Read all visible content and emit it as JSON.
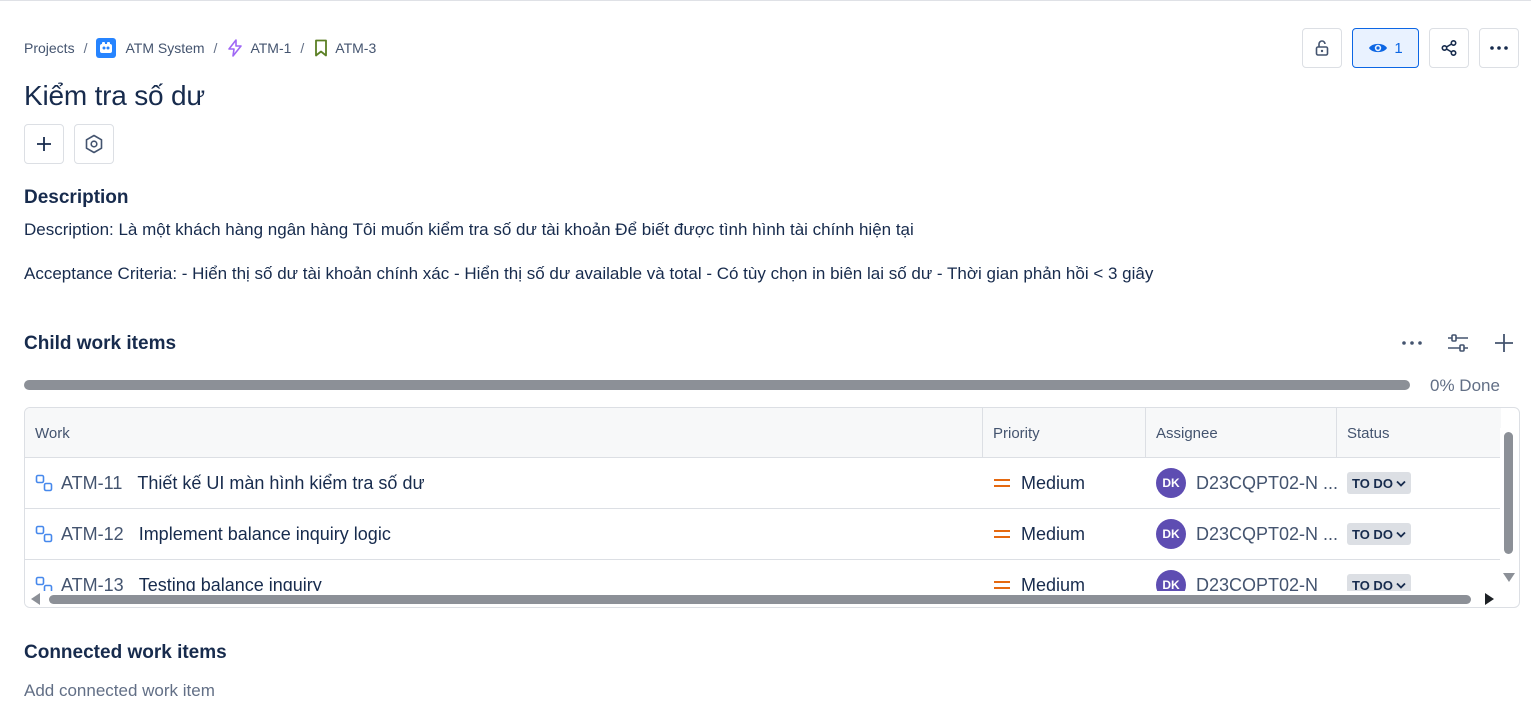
{
  "breadcrumb": {
    "projects": "Projects",
    "project": "ATM System",
    "epic": "ATM-1",
    "story": "ATM-3",
    "separator": "/"
  },
  "header": {
    "watch_count": "1",
    "icons": [
      "lock-open-icon",
      "eye-icon",
      "share-icon",
      "more-icon"
    ]
  },
  "issue": {
    "title": "Kiểm tra số dư"
  },
  "description": {
    "heading": "Description",
    "line1": "Description: Là một khách hàng ngân hàng Tôi muốn kiểm tra số dư tài khoản Để biết được tình hình tài chính hiện tại",
    "line2": "Acceptance Criteria: - Hiển thị số dư tài khoản chính xác - Hiển thị số dư available và total - Có tùy chọn in biên lai số dư - Thời gian phản hồi < 3 giây"
  },
  "child_items": {
    "heading": "Child work items",
    "progress_label": "0% Done",
    "progress_done_fraction": 0,
    "columns": [
      "Work",
      "Priority",
      "Assignee",
      "Status"
    ],
    "rows": [
      {
        "key": "ATM-11",
        "summary": "Thiết kế UI màn hình kiểm tra số dư",
        "priority": "Medium",
        "avatar": "DK",
        "assignee": "D23CQPT02-N ...",
        "status": "TO DO"
      },
      {
        "key": "ATM-12",
        "summary": "Implement balance inquiry logic",
        "priority": "Medium",
        "avatar": "DK",
        "assignee": "D23CQPT02-N ...",
        "status": "TO DO"
      },
      {
        "key": "ATM-13",
        "summary": "Testing balance inquiry",
        "priority": "Medium",
        "avatar": "DK",
        "assignee": "D23CQPT02-N",
        "status": "TO DO"
      }
    ]
  },
  "connected": {
    "heading": "Connected work items",
    "add_label": "Add connected work item"
  },
  "colors": {
    "accent": "#0c66e4",
    "priority_medium": "#e56910",
    "avatar": "#5e4db2",
    "subtask": "#4688ec",
    "epic": "#9f67f5",
    "story": "#5b7f24"
  }
}
